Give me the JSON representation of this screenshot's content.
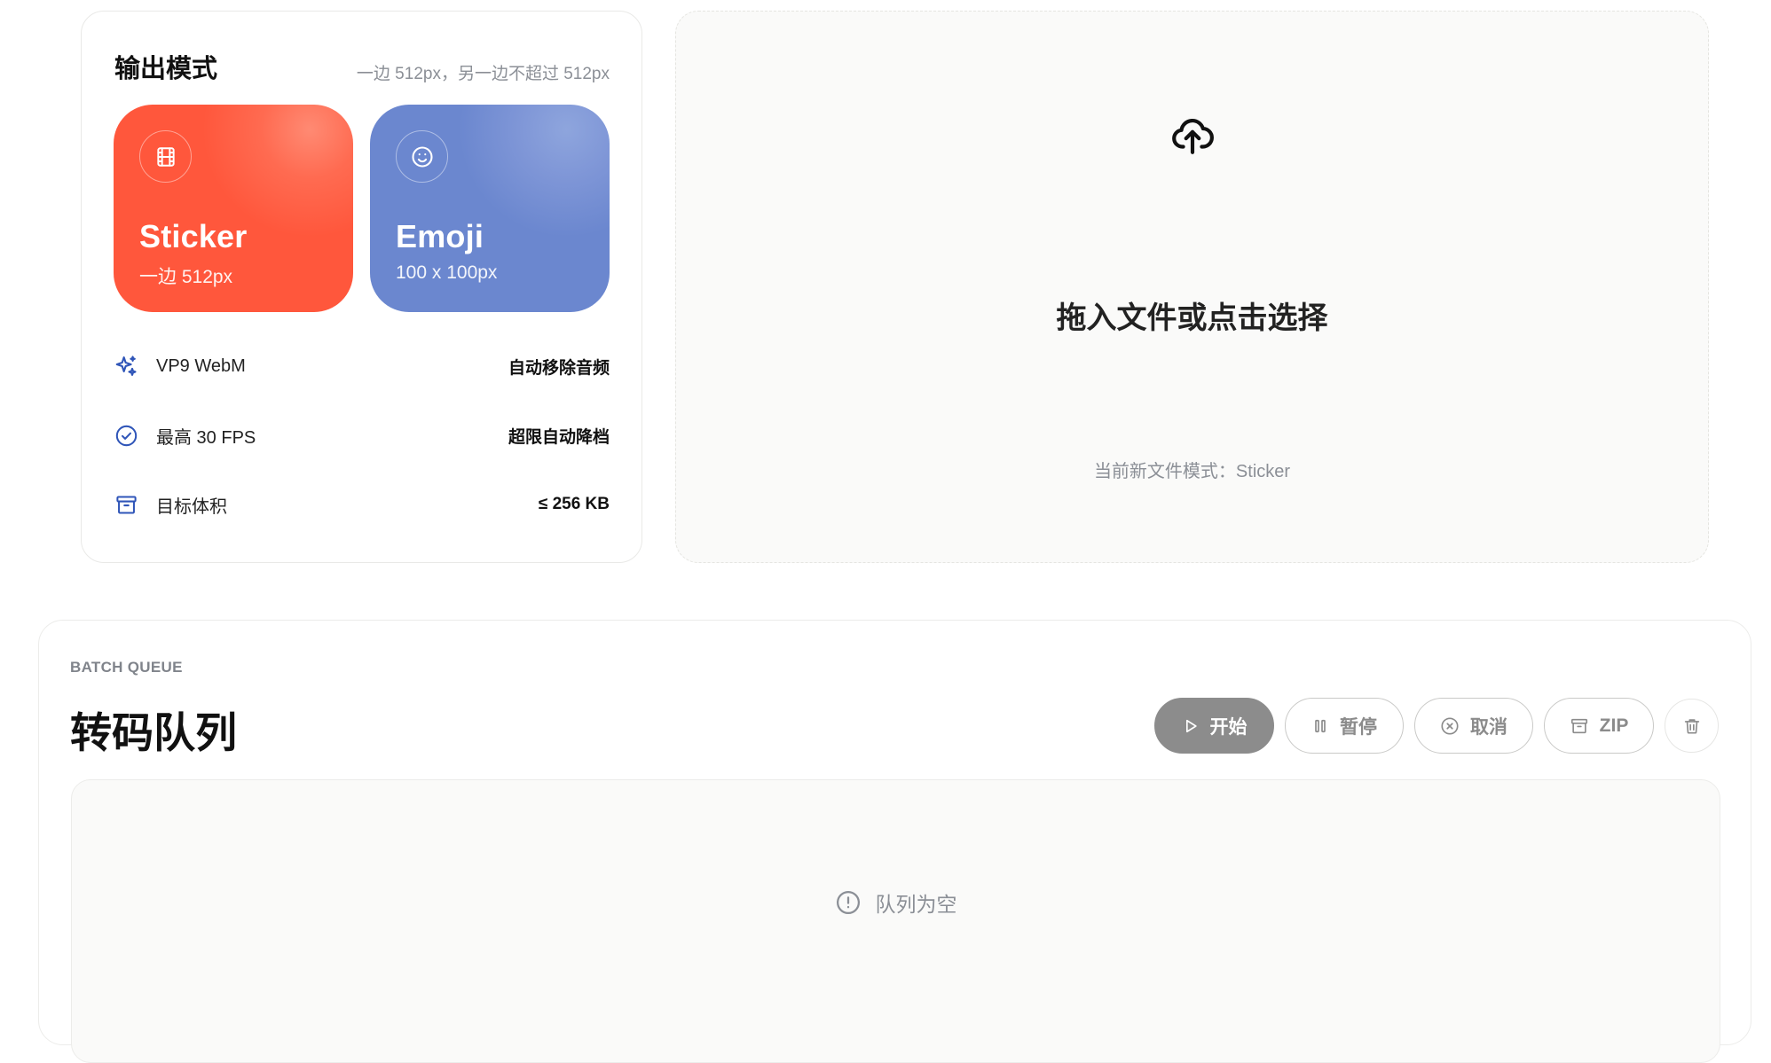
{
  "output_mode": {
    "title": "输出模式",
    "hint": "一边 512px，另一边不超过 512px",
    "tiles": [
      {
        "name": "Sticker",
        "subtitle": "一边 512px",
        "icon": "film-icon",
        "color": "#ff573c"
      },
      {
        "name": "Emoji",
        "subtitle": "100 x 100px",
        "icon": "smiley-icon",
        "color": "#6b87cf"
      }
    ],
    "specs": [
      {
        "icon": "sparkles-icon",
        "label": "VP9 WebM",
        "value": "自动移除音频"
      },
      {
        "icon": "check-circle-icon",
        "label": "最高 30 FPS",
        "value": "超限自动降档"
      },
      {
        "icon": "archive-icon",
        "label": "目标体积",
        "value": "≤ 256 KB"
      }
    ],
    "spec_icon_color": "#2f55b8"
  },
  "dropzone": {
    "icon": "cloud-upload-icon",
    "title": "拖入文件或点击选择",
    "mode_text": "当前新文件模式：Sticker"
  },
  "queue": {
    "eyebrow": "BATCH QUEUE",
    "title": "转码队列",
    "actions": {
      "start": "开始",
      "pause": "暂停",
      "cancel": "取消",
      "zip": "ZIP"
    },
    "empty_text": "队列为空",
    "empty_icon": "alert-circle-icon"
  }
}
